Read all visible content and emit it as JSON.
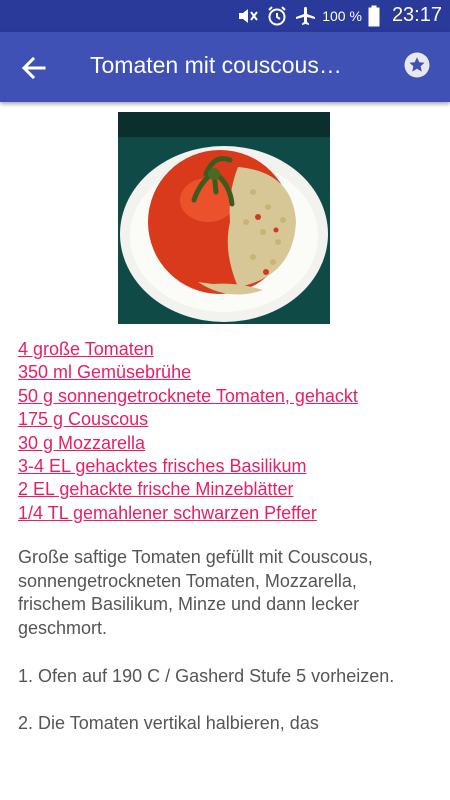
{
  "status_bar": {
    "battery_percent": "100 %",
    "time": "23:17",
    "icons": [
      "mute-icon",
      "alarm-icon",
      "airplane-icon",
      "battery-icon"
    ]
  },
  "app_bar": {
    "title": "Tomaten mit couscous…",
    "back_icon": "arrow-left-icon",
    "favorite_icon": "star-icon"
  },
  "recipe": {
    "image": "stuffed-tomato-photo",
    "ingredients": [
      "4 große Tomaten",
      "350 ml Gemüsebrühe",
      "50 g sonnengetrocknete Tomaten, gehackt",
      "175 g Couscous",
      "30 g Mozzarella",
      "3-4 EL gehacktes frisches Basilikum",
      "2 EL gehackte frische Minzeblätter",
      "1/4 TL gemahlener schwarzen Pfeffer"
    ],
    "description_lines": [
      "Große saftige Tomaten gefüllt mit Couscous,",
      "sonnengetrockneten Tomaten, Mozzarella,",
      "frischem Basilikum, Minze und dann lecker",
      "geschmort."
    ],
    "steps": [
      "1. Ofen auf 190 C / Gasherd Stufe 5 vorheizen.",
      "2. Die Tomaten vertikal halbieren, das"
    ]
  },
  "colors": {
    "status_bar": "#2a3a9b",
    "app_bar": "#3f51b5",
    "ingredient_link": "#e91e63",
    "body_text": "#555555"
  }
}
